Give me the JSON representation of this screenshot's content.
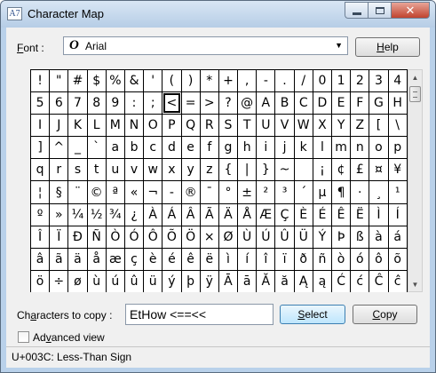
{
  "window": {
    "title": "Character Map",
    "icon_text": "A7"
  },
  "font": {
    "label_underline": "F",
    "label_rest": "ont :",
    "value": "Arial",
    "icon_glyph": "O"
  },
  "buttons": {
    "help_underline": "H",
    "help_rest": "elp",
    "select_underline": "S",
    "select_rest": "elect",
    "copy_underline": "C",
    "copy_rest": "opy"
  },
  "grid": {
    "selected_index": 27,
    "rows": [
      [
        "!",
        "\"",
        "#",
        "$",
        "%",
        "&",
        "'",
        "(",
        ")",
        "*",
        "+",
        ",",
        "-",
        ".",
        "/",
        "0",
        "1",
        "2",
        "3",
        "4"
      ],
      [
        "5",
        "6",
        "7",
        "8",
        "9",
        ":",
        ";",
        "<",
        "=",
        ">",
        "?",
        "@",
        "A",
        "B",
        "C",
        "D",
        "E",
        "F",
        "G",
        "H"
      ],
      [
        "I",
        "J",
        "K",
        "L",
        "M",
        "N",
        "O",
        "P",
        "Q",
        "R",
        "S",
        "T",
        "U",
        "V",
        "W",
        "X",
        "Y",
        "Z",
        "[",
        "\\"
      ],
      [
        "]",
        "^",
        "_",
        "`",
        "a",
        "b",
        "c",
        "d",
        "e",
        "f",
        "g",
        "h",
        "i",
        "j",
        "k",
        "l",
        "m",
        "n",
        "o",
        "p"
      ],
      [
        "q",
        "r",
        "s",
        "t",
        "u",
        "v",
        "w",
        "x",
        "y",
        "z",
        "{",
        "|",
        "}",
        "~",
        " ",
        "¡",
        "¢",
        "£",
        "¤",
        "¥"
      ],
      [
        "¦",
        "§",
        "¨",
        "©",
        "ª",
        "«",
        "¬",
        "-",
        "®",
        "¯",
        "°",
        "±",
        "²",
        "³",
        "´",
        "µ",
        "¶",
        "·",
        "¸",
        "¹"
      ],
      [
        "º",
        "»",
        "¼",
        "½",
        "¾",
        "¿",
        "À",
        "Á",
        "Â",
        "Ã",
        "Ä",
        "Å",
        "Æ",
        "Ç",
        "È",
        "É",
        "Ê",
        "Ë",
        "Ì",
        "Í"
      ],
      [
        "Î",
        "Ï",
        "Ð",
        "Ñ",
        "Ò",
        "Ó",
        "Ô",
        "Õ",
        "Ö",
        "×",
        "Ø",
        "Ù",
        "Ú",
        "Û",
        "Ü",
        "Ý",
        "Þ",
        "ß",
        "à",
        "á"
      ],
      [
        "â",
        "ã",
        "ä",
        "å",
        "æ",
        "ç",
        "è",
        "é",
        "ê",
        "ë",
        "ì",
        "í",
        "î",
        "ï",
        "ð",
        "ñ",
        "ò",
        "ó",
        "ô",
        "õ"
      ],
      [
        "ö",
        "÷",
        "ø",
        "ù",
        "ú",
        "û",
        "ü",
        "ý",
        "þ",
        "ÿ",
        "Ā",
        "ā",
        "Ă",
        "ă",
        "Ą",
        "ą",
        "Ć",
        "ć",
        "Ĉ",
        "ĉ"
      ]
    ]
  },
  "copy": {
    "label_pre": "Ch",
    "label_underline": "a",
    "label_rest": "racters to copy :",
    "value": "EtHow <==<<"
  },
  "advanced": {
    "label_pre": "Ad",
    "label_underline": "v",
    "label_rest": "anced view",
    "checked": false
  },
  "status": {
    "text": "U+003C: Less-Than Sign"
  },
  "colors": {
    "title_bar": "#b9d1ea",
    "close_button": "#c0432f",
    "select_button": "#bee6fd"
  }
}
